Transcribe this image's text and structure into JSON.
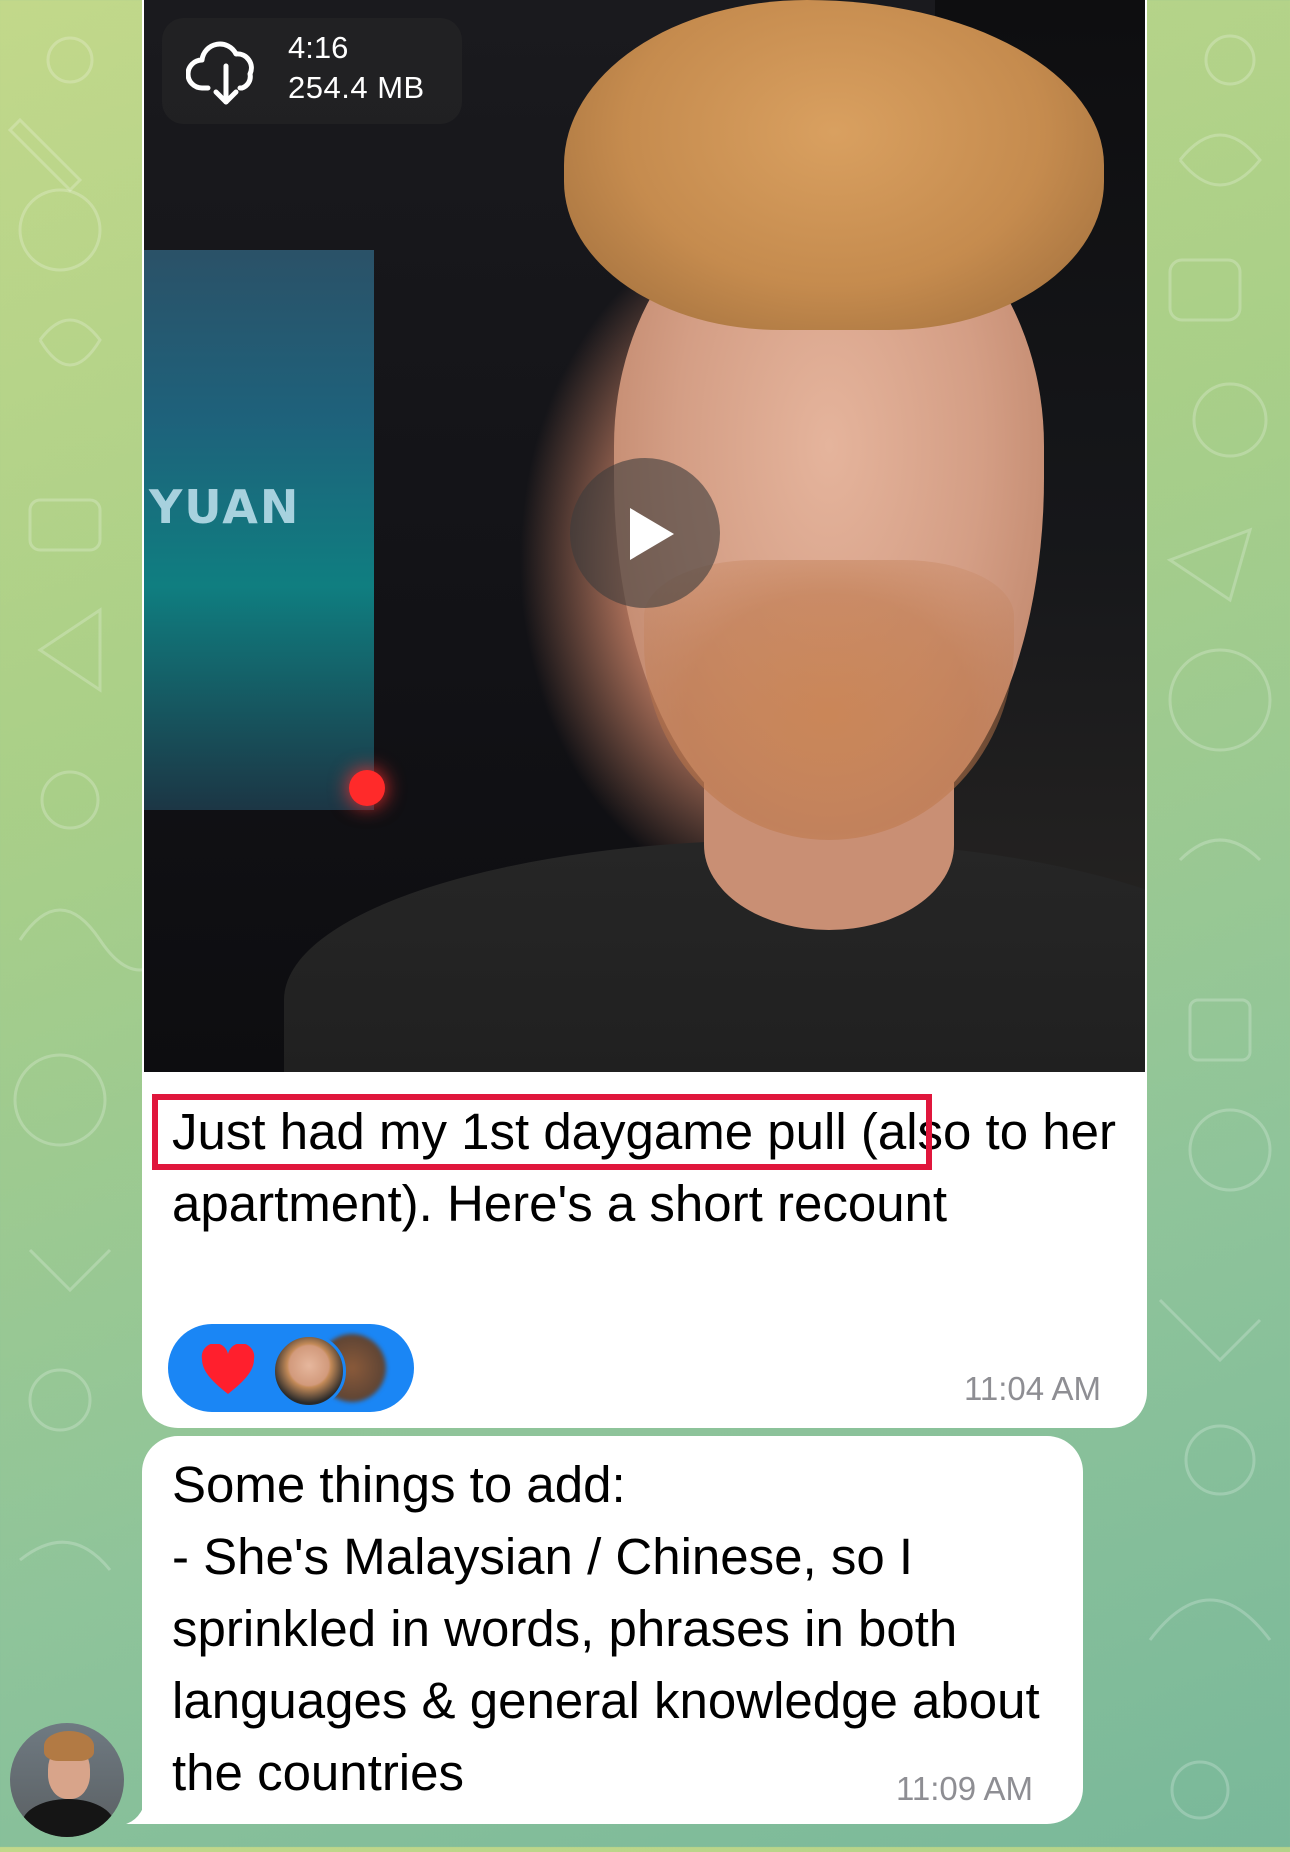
{
  "colors": {
    "bubble": "#ffffff",
    "highlight": "#e0163c",
    "reaction_pill": "#1a86f5",
    "timestamp": "#8e8e93"
  },
  "message1": {
    "video": {
      "duration": "4:16",
      "size": "254.4 MB",
      "download_icon": "cloud-download-icon",
      "play_icon": "play-icon"
    },
    "text": "Just had my 1st daygame pull (also to her apartment). Here's a short recount",
    "reactions": {
      "emoji_icon": "heart-icon",
      "reactor_count_avatars": 2
    },
    "time": "11:04 AM"
  },
  "message2": {
    "text": "Some things to add:\n- She's Malaysian / Chinese, so I sprinkled in words, phrases in both languages & general knowledge about the countries",
    "time": "11:09 AM"
  }
}
